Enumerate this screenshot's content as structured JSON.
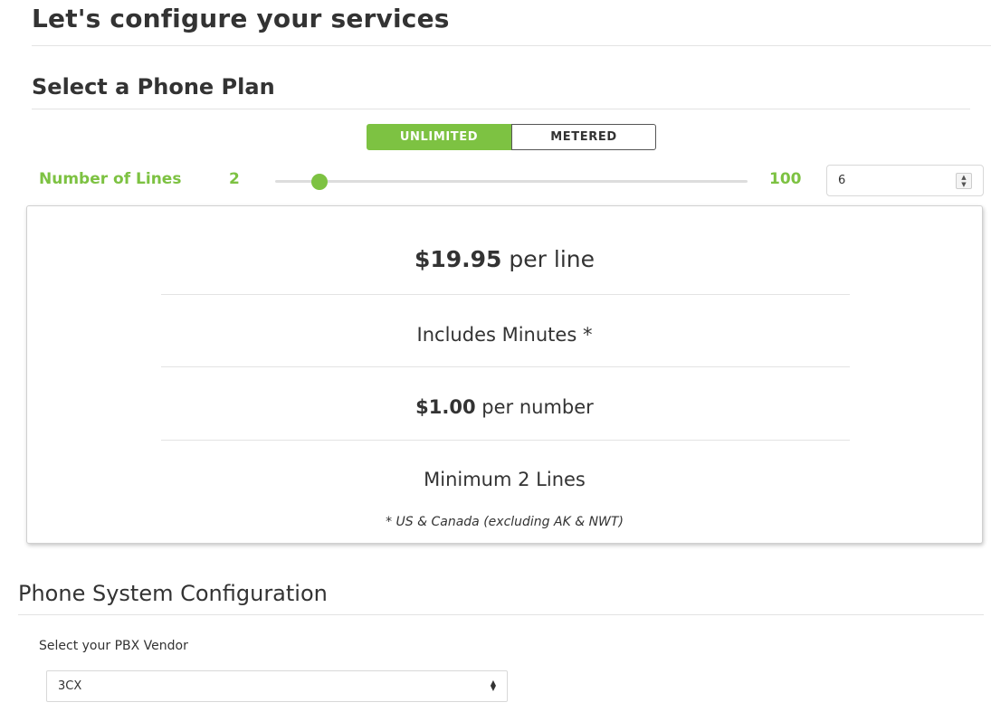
{
  "page": {
    "title": "Let's configure your services",
    "plan_heading": "Select a Phone Plan"
  },
  "plan_toggle": {
    "options": [
      "UNLIMITED",
      "METERED"
    ],
    "selected": "UNLIMITED",
    "accent_color": "#7dc242"
  },
  "lines": {
    "label": "Number of Lines",
    "min_label": "2",
    "max_label": "100",
    "value": "6",
    "min": 2,
    "max": 100
  },
  "plan_card": {
    "price_amount": "$19.95",
    "price_unit": " per line",
    "minutes": "Includes Minutes *",
    "number_amount": "$1.00",
    "number_unit": " per number",
    "minimum": "Minimum 2 Lines",
    "footnote": "* US & Canada (excluding AK & NWT)"
  },
  "config": {
    "heading": "Phone System Configuration",
    "vendor_label": "Select your PBX Vendor",
    "vendor_selected": "3CX"
  },
  "icons": {
    "spinner": "spinner-icon",
    "select_caret": "select-caret-icon"
  }
}
